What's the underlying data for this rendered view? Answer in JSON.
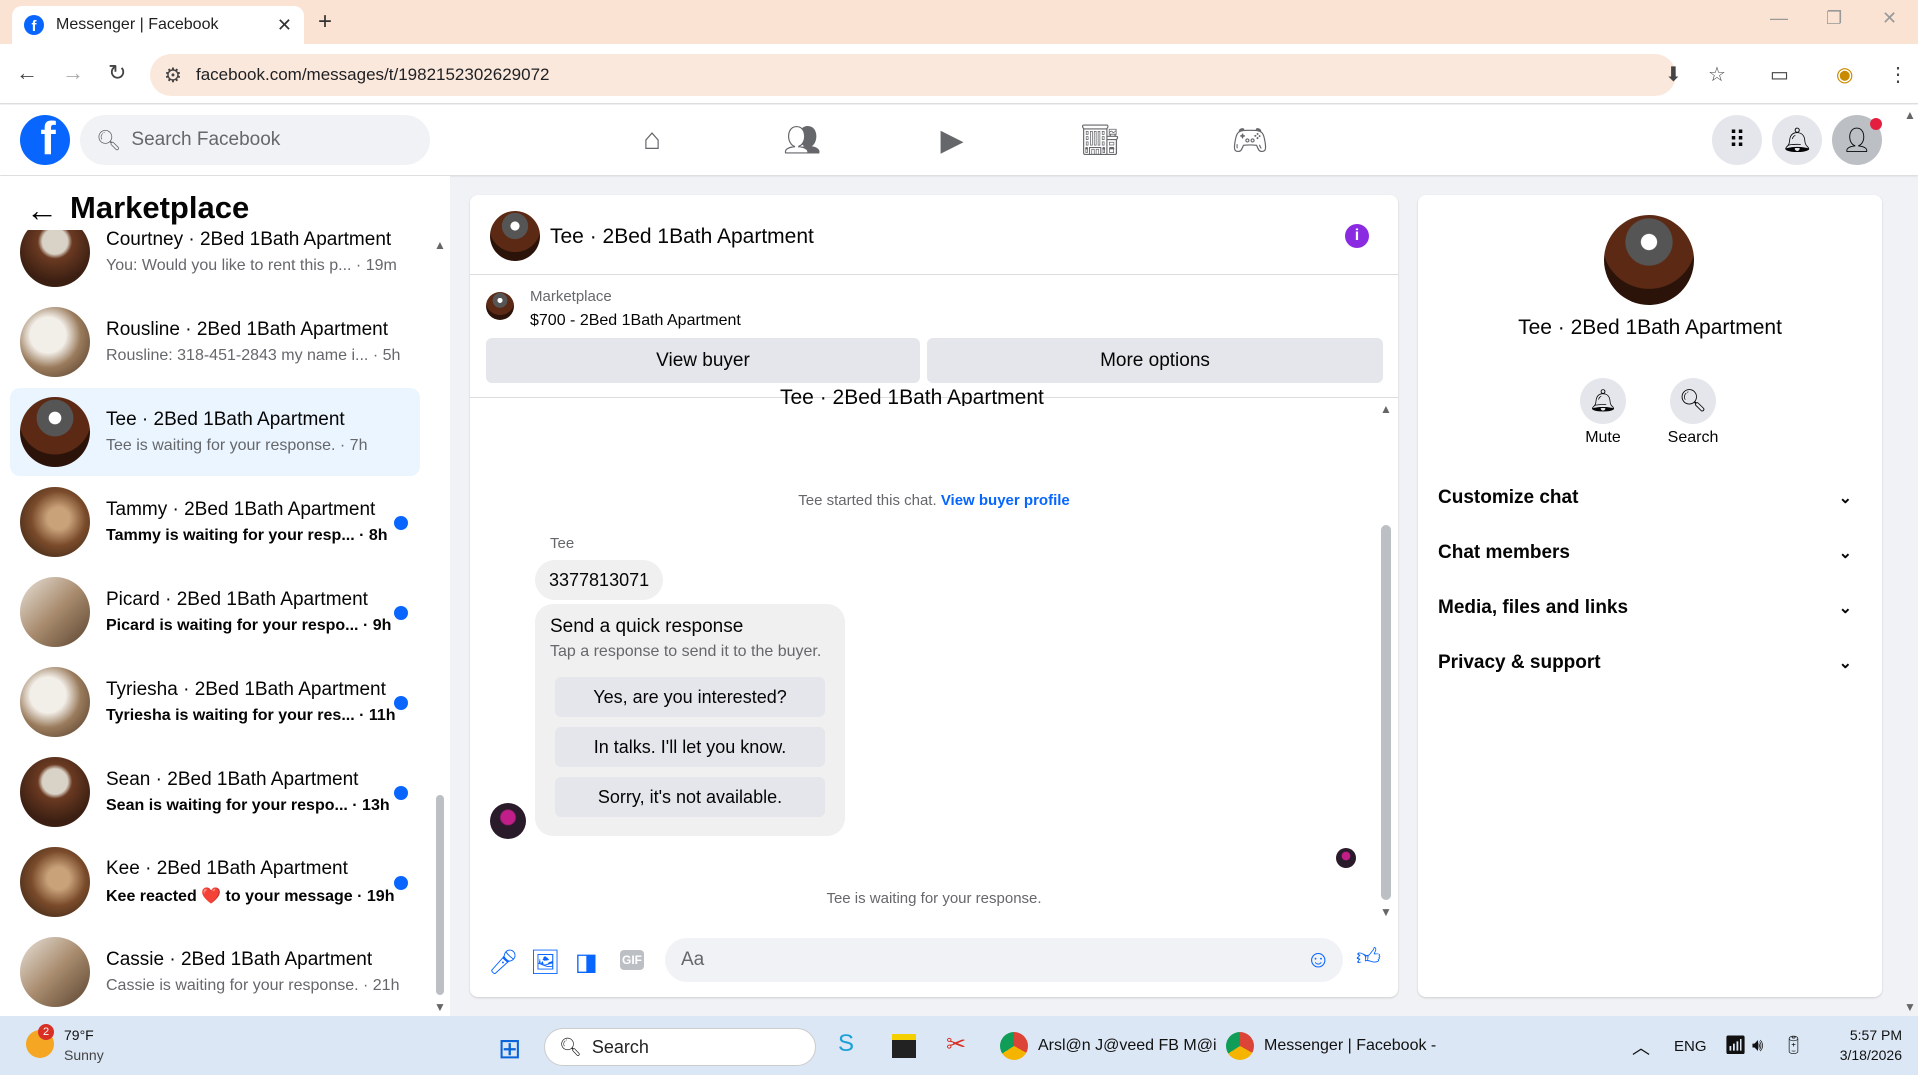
{
  "browser": {
    "tab_title": "Messenger | Facebook",
    "url": "facebook.com/messages/t/1982152302629072"
  },
  "fb": {
    "search_placeholder": "Search Facebook"
  },
  "sidebar": {
    "title": "Marketplace",
    "conversations": [
      {
        "name": "Courtney · 2Bed 1Bath Apartment",
        "preview": "You: Would you like to rent this p... · 19m",
        "unread": false
      },
      {
        "name": "Rousline · 2Bed 1Bath Apartment",
        "preview": "Rousline: 318-451-2843 my name i... · 5h",
        "unread": false
      },
      {
        "name": "Tee · 2Bed 1Bath Apartment",
        "preview": "Tee is waiting for your response. · 7h",
        "unread": false
      },
      {
        "name": "Tammy · 2Bed 1Bath Apartment",
        "preview": "Tammy is waiting for your resp... · 8h",
        "unread": true
      },
      {
        "name": "Picard · 2Bed 1Bath Apartment",
        "preview": "Picard is waiting for your respo... · 9h",
        "unread": true
      },
      {
        "name": "Tyriesha · 2Bed 1Bath Apartment",
        "preview": "Tyriesha is waiting for your res... · 11h",
        "unread": true
      },
      {
        "name": "Sean · 2Bed 1Bath Apartment",
        "preview": "Sean is waiting for your respo... · 13h",
        "unread": true
      },
      {
        "name": "Kee · 2Bed 1Bath Apartment",
        "preview": "Kee reacted ❤️ to your message · 19h",
        "unread": true
      },
      {
        "name": "Cassie · 2Bed 1Bath Apartment",
        "preview": "Cassie is waiting for your response. · 21h",
        "unread": false
      }
    ]
  },
  "chat": {
    "title": "Tee · 2Bed 1Bath Apartment",
    "marketplace_label": "Marketplace",
    "listing": "$700 - 2Bed 1Bath Apartment",
    "view_buyer": "View buyer",
    "more_options": "More options",
    "started_text": "Tee started this chat.",
    "view_buyer_profile": "View buyer profile",
    "sender": "Tee",
    "message": "3377813071",
    "quick_title": "Send a quick response",
    "quick_sub": "Tap a response to send it to the buyer.",
    "quick_responses": [
      "Yes, are you interested?",
      "In talks. I'll let you know.",
      "Sorry, it's not available."
    ],
    "waiting": "Tee is waiting for your response.",
    "composer_placeholder": "Aa"
  },
  "info": {
    "title": "Tee · 2Bed 1Bath Apartment",
    "mute": "Mute",
    "search": "Search",
    "rows": [
      "Customize chat",
      "Chat members",
      "Media, files and links",
      "Privacy & support"
    ]
  },
  "taskbar": {
    "weather_temp": "79°F",
    "weather_desc": "Sunny",
    "weather_badge": "2",
    "search": "Search",
    "app1": "Arsl@n J@veed FB M@i",
    "app2": "Messenger | Facebook -",
    "lang": "ENG",
    "time": "5:57 PM",
    "date": "3/18/2026"
  },
  "colors": {
    "accent": "#0866ff",
    "info_icon": "#8a2be2"
  }
}
